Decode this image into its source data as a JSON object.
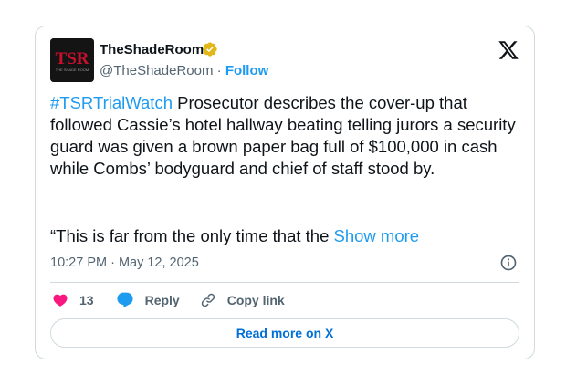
{
  "author": {
    "name": "TheShadeRoom",
    "handle": "@TheShadeRoom",
    "separator": " · ",
    "follow_label": "Follow",
    "avatar_text": "TSR",
    "avatar_subtext": "THE SHADE ROOM"
  },
  "tweet": {
    "hashtag": "#TSRTrialWatch",
    "text": " Prosecutor describes the cover-up that followed Cassie’s hotel hallway beating telling jurors a security guard was given a brown paper bag full of $100,000 in cash while Combs’ bodyguard and chief of staff stood by.",
    "text_line2": "“This is far from the only time that the ",
    "show_more_label": "Show more",
    "timestamp": "10:27 PM · May 12, 2025"
  },
  "actions": {
    "like_count": "13",
    "reply_label": "Reply",
    "copy_link_label": "Copy link"
  },
  "read_more_label": "Read more on X",
  "colors": {
    "link": "#1d9bf0",
    "like": "#f91880",
    "reply": "#1d9bf0",
    "verified": "#e2b719",
    "avatar_logo": "#c8102e"
  },
  "icons": {
    "verified": "gold-verified-badge-icon",
    "x_logo": "x-logo-icon",
    "info": "info-circle-icon",
    "like": "heart-icon",
    "reply": "speech-bubble-icon",
    "copy_link": "link-icon"
  }
}
